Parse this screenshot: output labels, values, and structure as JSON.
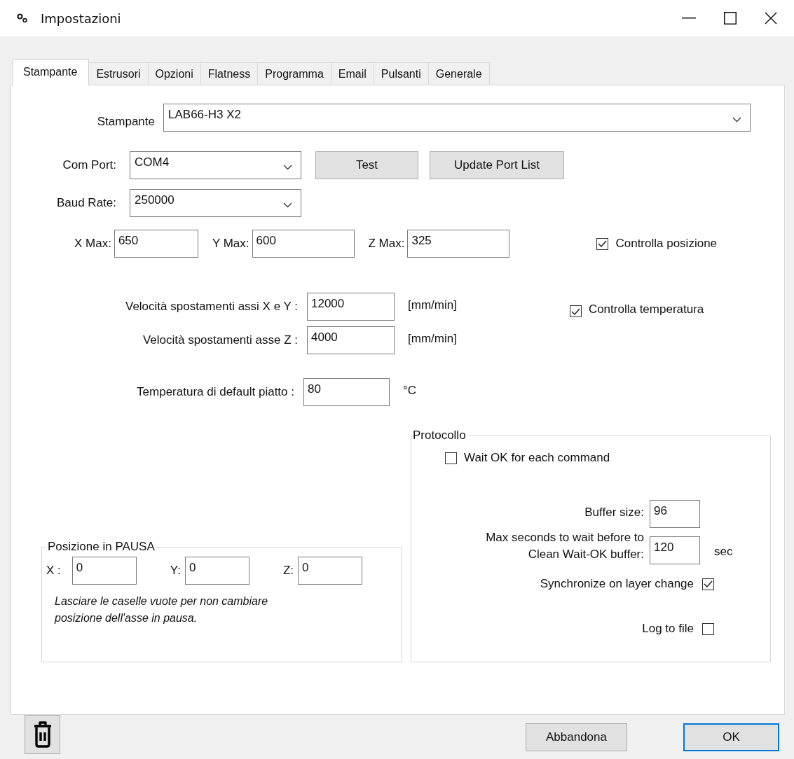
{
  "window": {
    "title": "Impostazioni"
  },
  "tabs": [
    {
      "label": "Stampante",
      "selected": true
    },
    {
      "label": "Estrusori",
      "selected": false
    },
    {
      "label": "Opzioni",
      "selected": false
    },
    {
      "label": "Flatness",
      "selected": false
    },
    {
      "label": "Programma",
      "selected": false
    },
    {
      "label": "Email",
      "selected": false
    },
    {
      "label": "Pulsanti",
      "selected": false
    },
    {
      "label": "Generale",
      "selected": false
    }
  ],
  "printer": {
    "label": "Stampante",
    "value": "LAB66-H3  X2"
  },
  "com_port": {
    "label": "Com Port:",
    "value": "COM4"
  },
  "port_buttons": [
    "Test",
    "Update Port List"
  ],
  "baud_rate": {
    "label": "Baud Rate:",
    "value": "250000"
  },
  "limits": [
    {
      "label": "X Max:",
      "value": "650"
    },
    {
      "label": "Y Max:",
      "value": "600"
    },
    {
      "label": "Z Max:",
      "value": "325"
    }
  ],
  "checks": [
    {
      "label": "Controlla posizione",
      "checked": true
    },
    {
      "label": "Controlla temperatura",
      "checked": true
    }
  ],
  "speeds": [
    {
      "label": "Velocità spostamenti assi X e Y :",
      "value": "12000",
      "unit": "[mm/min]"
    },
    {
      "label": "Velocità spostamenti asse Z :",
      "value": "4000",
      "unit": "[mm/min]"
    }
  ],
  "bed_temp": {
    "label": "Temperatura di default piatto :",
    "value": "80",
    "unit": "°C"
  },
  "protocol": {
    "title": "Protocollo",
    "wait_ok": {
      "label": "Wait OK for each command",
      "checked": false
    },
    "buffer_size": {
      "label": "Buffer size:",
      "value": "96"
    },
    "max_wait": {
      "label_lines": [
        "Max seconds to wait before to",
        "Clean Wait-OK buffer:"
      ],
      "value": "120",
      "unit": "sec"
    },
    "sync": {
      "label": "Synchronize on layer change",
      "checked": true
    },
    "log": {
      "label": "Log to file",
      "checked": false
    }
  },
  "pause": {
    "title": "Posizione in PAUSA",
    "fields": [
      {
        "label": "X :",
        "value": "0"
      },
      {
        "label": "Y:",
        "value": "0"
      },
      {
        "label": "Z:",
        "value": "0"
      }
    ],
    "note_lines": [
      "Lasciare le caselle vuote per non cambiare",
      "posizione dell'asse in pausa."
    ]
  },
  "buttons": {
    "cancel": "Abbandona",
    "ok": "OK"
  }
}
